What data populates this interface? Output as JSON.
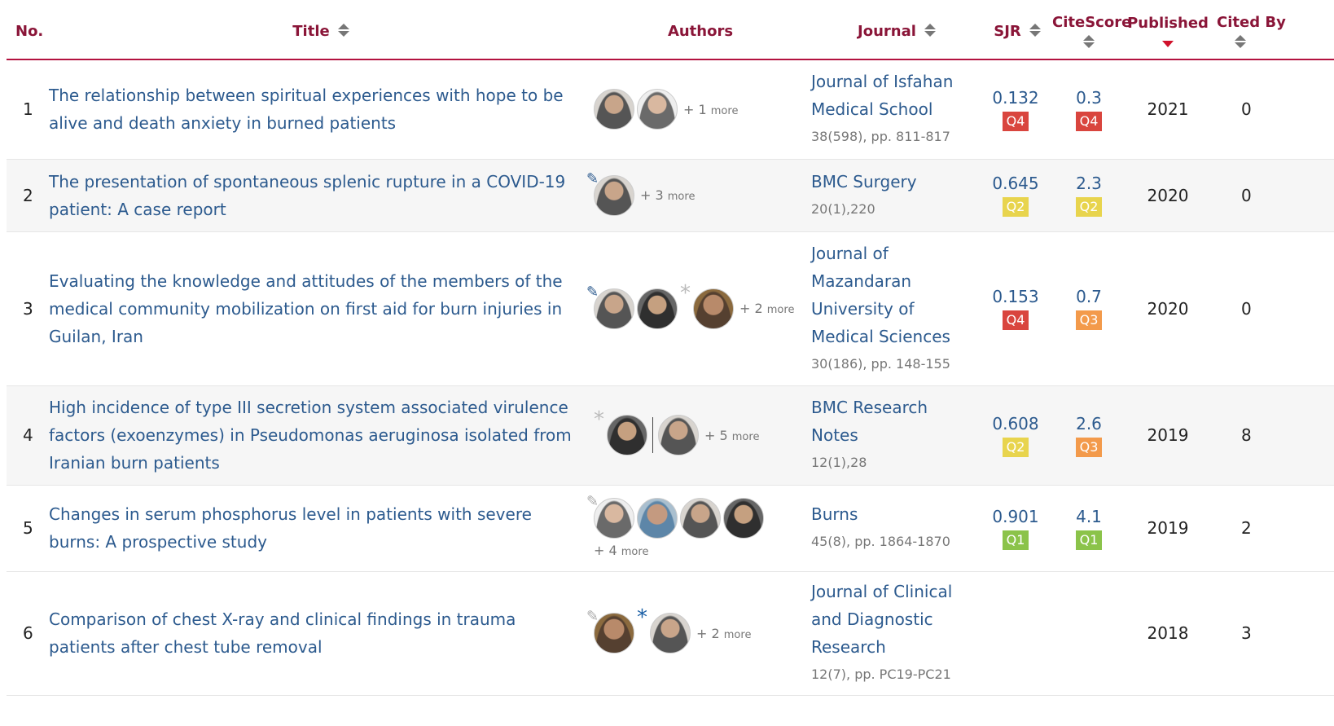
{
  "headers": {
    "no": "No.",
    "title": "Title",
    "authors": "Authors",
    "journal": "Journal",
    "sjr": "SJR",
    "citescore": "CiteScore",
    "published": "Published",
    "cited_by": "Cited By"
  },
  "rows": [
    {
      "no": "1",
      "title": "The relationship between spiritual experiences with hope to be alive and death anxiety in burned patients",
      "more": "+ 1",
      "more_word": "more",
      "journal": "Journal of Isfahan Medical School",
      "journal_info": "38(598), pp. 811-817",
      "sjr": "0.132",
      "sjr_q": "Q4",
      "citescore": "0.3",
      "cs_q": "Q4",
      "published": "2021",
      "cited_by": "0"
    },
    {
      "no": "2",
      "title": "The presentation of spontaneous splenic rupture in a COVID-19 patient: A case report",
      "more": "+ 3",
      "more_word": "more",
      "journal": "BMC Surgery",
      "journal_info": "20(1),220",
      "sjr": "0.645",
      "sjr_q": "Q2",
      "citescore": "2.3",
      "cs_q": "Q2",
      "published": "2020",
      "cited_by": "0"
    },
    {
      "no": "3",
      "title": "Evaluating the knowledge and attitudes of the members of the medical community mobilization on first aid for burn injuries in Guilan, Iran",
      "more": "+ 2",
      "more_word": "more",
      "journal": "Journal of Mazandaran University of Medical Sciences",
      "journal_info": "30(186), pp. 148-155",
      "sjr": "0.153",
      "sjr_q": "Q4",
      "citescore": "0.7",
      "cs_q": "Q3",
      "published": "2020",
      "cited_by": "0"
    },
    {
      "no": "4",
      "title": "High incidence of type III secretion system associated virulence factors (exoenzymes) in Pseudomonas aeruginosa isolated from Iranian burn patients",
      "more": "+ 5",
      "more_word": "more",
      "journal": "BMC Research Notes",
      "journal_info": "12(1),28",
      "sjr": "0.608",
      "sjr_q": "Q2",
      "citescore": "2.6",
      "cs_q": "Q3",
      "published": "2019",
      "cited_by": "8"
    },
    {
      "no": "5",
      "title": "Changes in serum phosphorus level in patients with severe burns: A prospective study",
      "more": "+ 4",
      "more_word": "more",
      "journal": "Burns",
      "journal_info": "45(8), pp. 1864-1870",
      "sjr": "0.901",
      "sjr_q": "Q1",
      "citescore": "4.1",
      "cs_q": "Q1",
      "published": "2019",
      "cited_by": "2"
    },
    {
      "no": "6",
      "title": "Comparison of chest X-ray and clinical findings in trauma patients after chest tube removal",
      "more": "+ 2",
      "more_word": "more",
      "journal": "Journal of Clinical and Diagnostic Research",
      "journal_info": "12(7), pp. PC19-PC21",
      "published": "2018",
      "cited_by": "3"
    }
  ],
  "icons": {
    "edit": "pencil-icon",
    "star": "asterisk-icon",
    "sort": "sort-icon",
    "sort_desc": "sort-desc-icon"
  },
  "colors": {
    "header_text": "#8a1538",
    "header_rule": "#b3123f",
    "link": "#2c5a8e",
    "q1": "#8bc34a",
    "q2": "#e8d44d",
    "q3": "#f39a4b",
    "q4": "#d9453e"
  }
}
